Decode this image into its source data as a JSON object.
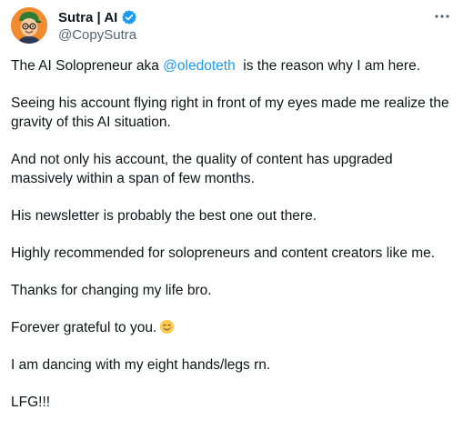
{
  "author": {
    "display_name": "Sutra | AI",
    "handle": "@CopySutra",
    "verified": true,
    "avatar_icon": "cartoon-avatar-icon",
    "verified_icon": "verified-badge-icon",
    "colors": {
      "avatar_bg": "#f28a2e",
      "verified": "#1d9bf0",
      "mention": "#1d9bf0",
      "handle": "#536471"
    }
  },
  "menu": {
    "icon": "more-options-icon"
  },
  "tweet": {
    "line1_prefix": "The AI Solopreneur aka ",
    "line1_mention": "@oledoteth",
    "line1_suffix": "  is the reason why I am here.",
    "p2": "Seeing his account flying right in front of my eyes made me realize the gravity of this AI situation.",
    "p3": "And not only his account, the quality of content has upgraded massively within a span of few months.",
    "p4": "His newsletter is probably the best one out there.",
    "p5": "Highly recommended for solopreneurs and content creators like me.",
    "p6": "Thanks for changing my life bro.",
    "p7": "Forever grateful to you.",
    "p7_emoji": "smiling-face-with-tear-icon",
    "p8": "I am dancing with my eight hands/legs rn.",
    "p9": "LFG!!!"
  }
}
